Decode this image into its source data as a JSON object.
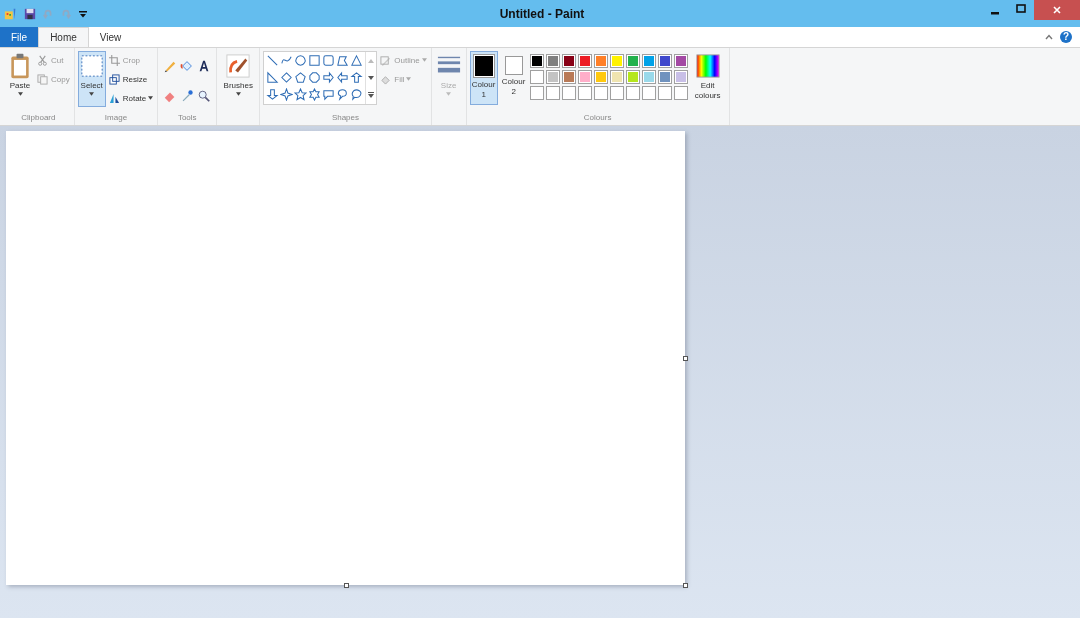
{
  "window": {
    "title": "Untitled - Paint"
  },
  "tabs": [
    {
      "label": "File",
      "kind": "menu",
      "selected": false
    },
    {
      "label": "Home",
      "kind": "tab",
      "selected": true
    },
    {
      "label": "View",
      "kind": "tab",
      "selected": false
    }
  ],
  "help": {
    "label": "?"
  },
  "clipboard": {
    "group": "Clipboard",
    "paste": "Paste",
    "cut": {
      "label": "Cut",
      "disabled": true
    },
    "copy": {
      "label": "Copy",
      "disabled": true
    }
  },
  "image": {
    "group": "Image",
    "select": {
      "label": "Select",
      "selected": true
    },
    "crop": {
      "label": "Crop",
      "disabled": true
    },
    "resize": {
      "label": "Resize",
      "disabled": false
    },
    "rotate": {
      "label": "Rotate",
      "disabled": false
    }
  },
  "tools": {
    "group": "Tools"
  },
  "brushes": {
    "label": "Brushes"
  },
  "shapes": {
    "group": "Shapes",
    "outline": {
      "label": "Outline",
      "disabled": true
    },
    "fill": {
      "label": "Fill",
      "disabled": true
    }
  },
  "size": {
    "label": "Size",
    "disabled": true
  },
  "colours": {
    "group": "Colours",
    "colour1": {
      "label": "Colour 1",
      "color": "#000000",
      "selected": true
    },
    "colour2": {
      "label": "Colour 2",
      "color": "#ffffff",
      "selected": false
    },
    "edit": "Edit colours",
    "palette": [
      [
        {
          "kind": "swatch",
          "color": "#000000"
        },
        {
          "kind": "swatch",
          "color": "#7f7f7f"
        },
        {
          "kind": "swatch",
          "color": "#880015"
        },
        {
          "kind": "swatch",
          "color": "#ed1c24"
        },
        {
          "kind": "swatch",
          "color": "#ff7f27"
        },
        {
          "kind": "swatch",
          "color": "#fff200"
        },
        {
          "kind": "swatch",
          "color": "#22b14c"
        },
        {
          "kind": "swatch",
          "color": "#00a2e8"
        },
        {
          "kind": "swatch",
          "color": "#3f48cc"
        },
        {
          "kind": "swatch",
          "color": "#a349a4"
        }
      ],
      [
        {
          "kind": "swatch",
          "color": "#ffffff"
        },
        {
          "kind": "swatch",
          "color": "#c3c3c3"
        },
        {
          "kind": "swatch",
          "color": "#b97a57"
        },
        {
          "kind": "swatch",
          "color": "#ffaec9"
        },
        {
          "kind": "swatch",
          "color": "#ffc90e"
        },
        {
          "kind": "swatch",
          "color": "#efe4b0"
        },
        {
          "kind": "swatch",
          "color": "#b5e61d"
        },
        {
          "kind": "swatch",
          "color": "#99d9ea"
        },
        {
          "kind": "swatch",
          "color": "#7092be"
        },
        {
          "kind": "swatch",
          "color": "#c8bfe7"
        }
      ],
      [
        {
          "kind": "empty"
        },
        {
          "kind": "empty"
        },
        {
          "kind": "empty"
        },
        {
          "kind": "empty"
        },
        {
          "kind": "empty"
        },
        {
          "kind": "empty"
        },
        {
          "kind": "empty"
        },
        {
          "kind": "empty"
        },
        {
          "kind": "empty"
        },
        {
          "kind": "empty"
        }
      ]
    ]
  }
}
